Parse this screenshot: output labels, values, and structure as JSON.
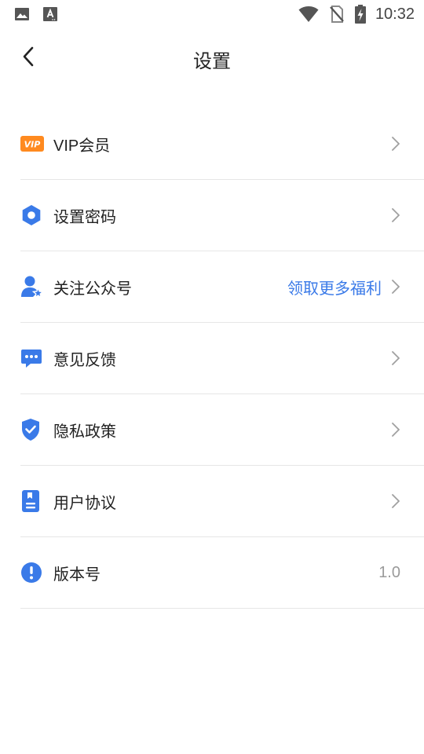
{
  "status_bar": {
    "time": "10:32",
    "left_icons": [
      "image-notification-icon",
      "font-notification-icon"
    ],
    "right_icons": [
      "wifi-icon",
      "no-sim-icon",
      "battery-charging-icon"
    ]
  },
  "header": {
    "title": "设置",
    "back_icon": "chevron-left-icon"
  },
  "accent_color": "#3a7ae8",
  "vip_color": "#ff8a1f",
  "settings": {
    "items": [
      {
        "label": "VIP会员",
        "icon": "vip-badge-icon",
        "value": ""
      },
      {
        "label": "设置密码",
        "icon": "gear-icon",
        "value": ""
      },
      {
        "label": "关注公众号",
        "icon": "user-star-icon",
        "value": "领取更多福利"
      },
      {
        "label": "意见反馈",
        "icon": "chat-bubble-icon",
        "value": ""
      },
      {
        "label": "隐私政策",
        "icon": "shield-check-icon",
        "value": ""
      },
      {
        "label": "用户协议",
        "icon": "document-icon",
        "value": ""
      },
      {
        "label": "版本号",
        "icon": "info-exclamation-icon",
        "value": "1.0"
      }
    ]
  }
}
